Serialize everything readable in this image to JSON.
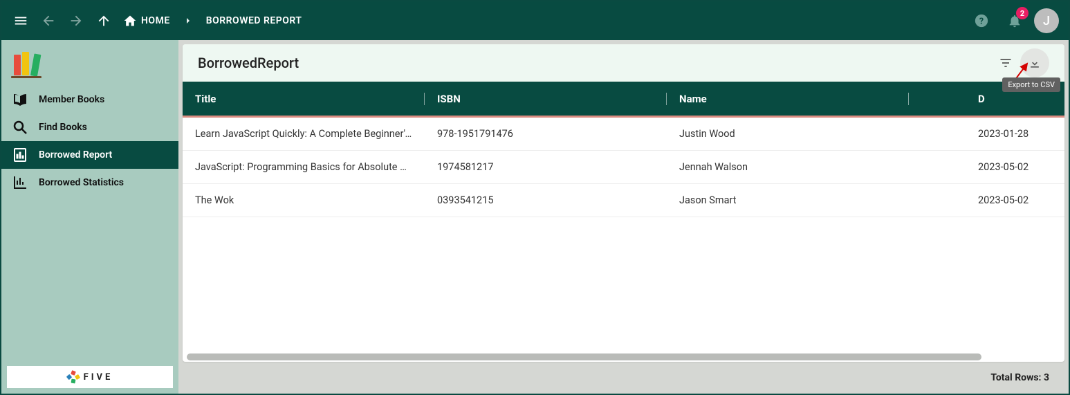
{
  "appbar": {
    "home_label": "HOME",
    "page_label": "BORROWED REPORT",
    "badge_count": "2",
    "avatar_initial": "J"
  },
  "sidebar": {
    "items": [
      {
        "label": "Member Books"
      },
      {
        "label": "Find Books"
      },
      {
        "label": "Borrowed Report"
      },
      {
        "label": "Borrowed Statistics"
      }
    ],
    "footer_brand": "FIVE"
  },
  "page": {
    "title": "BorrowedReport",
    "tooltip_export": "Export to CSV",
    "columns": {
      "title": "Title",
      "isbn": "ISBN",
      "name": "Name",
      "date": "D"
    },
    "rows": [
      {
        "title": "Learn JavaScript Quickly: A Complete Beginner's…",
        "isbn": "978-1951791476",
        "name": "Justin Wood",
        "date": "2023-01-28"
      },
      {
        "title": "JavaScript: Programming Basics for Absolute Be…",
        "isbn": "1974581217",
        "name": "Jennah Walson",
        "date": "2023-05-02"
      },
      {
        "title": "The Wok",
        "isbn": "0393541215",
        "name": "Jason Smart",
        "date": "2023-05-02"
      }
    ],
    "footer_total": "Total Rows: 3"
  }
}
